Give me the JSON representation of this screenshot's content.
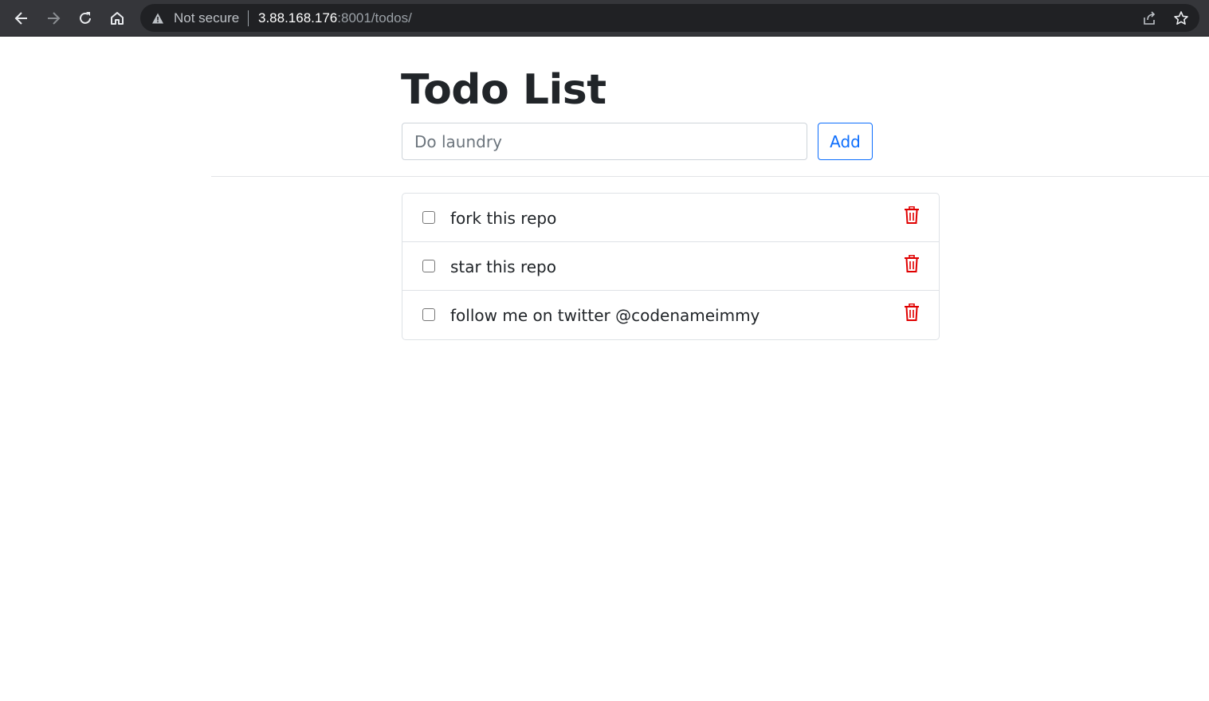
{
  "browser": {
    "security_label": "Not secure",
    "url_host": "3.88.168.176",
    "url_rest": ":8001/todos/",
    "icons": {
      "back": "arrow-left-icon",
      "forward": "arrow-right-icon",
      "reload": "reload-icon",
      "home": "home-icon",
      "warning": "warning-icon",
      "share": "share-icon",
      "bookmark": "star-icon"
    }
  },
  "page": {
    "title": "Todo List",
    "input": {
      "value": "",
      "placeholder": "Do laundry"
    },
    "add_label": "Add"
  },
  "todos": [
    {
      "text": "fork this repo",
      "done": false
    },
    {
      "text": "star this repo",
      "done": false
    },
    {
      "text": "follow me on twitter @codenameimmy",
      "done": false
    }
  ],
  "colors": {
    "accent": "#0d6efd",
    "danger": "#dc3545",
    "chrome_bg": "#35363a",
    "omnibox_bg": "#202124"
  }
}
